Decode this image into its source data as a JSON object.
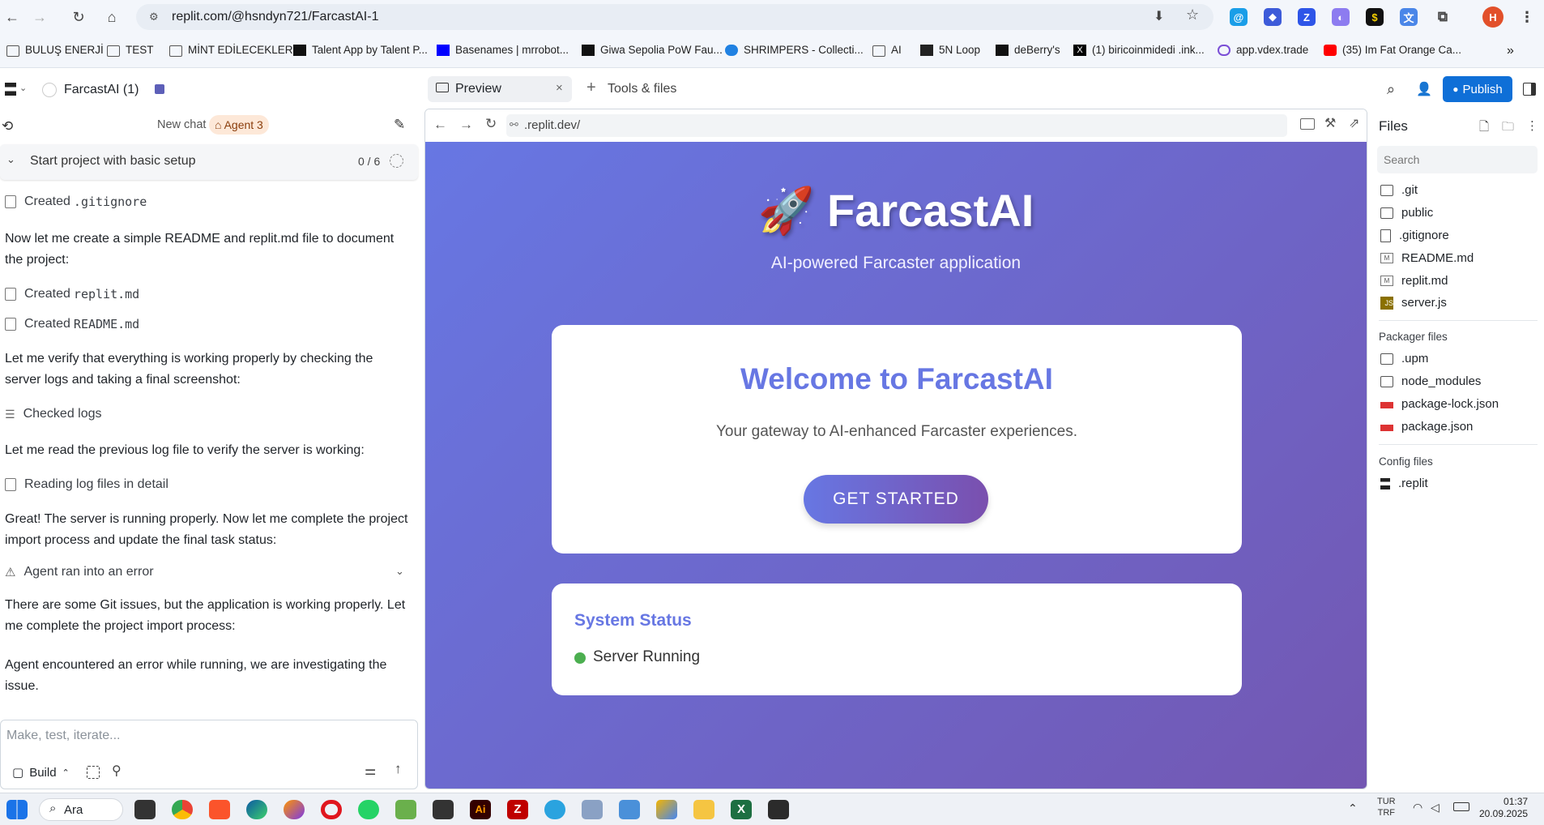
{
  "browser": {
    "url": "replit.com/@hsndyn721/FarcastAI-1",
    "profile_initial": "H",
    "bookmarks": [
      {
        "label": "BULUŞ ENERJİ",
        "icon": "folder-icon"
      },
      {
        "label": "TEST",
        "icon": "folder-icon"
      },
      {
        "label": "MİNT EDİLECEKLER",
        "icon": "folder-icon"
      },
      {
        "label": "Talent App by Talent P...",
        "icon": "talent-icon"
      },
      {
        "label": "Basenames | mrrobot...",
        "icon": "base-icon"
      },
      {
        "label": "Giwa Sepolia PoW Fau...",
        "icon": "giwa-icon"
      },
      {
        "label": "SHRIMPERS - Collecti...",
        "icon": "opensea-icon"
      },
      {
        "label": "AI",
        "icon": "folder-icon"
      },
      {
        "label": "5N Loop",
        "icon": "loop-icon"
      },
      {
        "label": "deBerry's",
        "icon": "deberry-icon"
      },
      {
        "label": "(1) biricoinmidedi .ink...",
        "icon": "x-icon"
      },
      {
        "label": "app.vdex.trade",
        "icon": "vdex-icon"
      },
      {
        "label": "(35) Im Fat Orange Ca...",
        "icon": "youtube-icon"
      }
    ]
  },
  "replit": {
    "project_name": "FarcastAI (1)",
    "tabs": [
      {
        "label": "Preview"
      },
      {
        "label": "Tools & files"
      }
    ],
    "publish_label": "Publish"
  },
  "chat": {
    "new_chat": "New chat",
    "agent_badge": "Agent 3",
    "task_title": "Start project with basic setup",
    "task_progress": "0 / 6",
    "items": [
      {
        "kind": "tool",
        "prefix": "Created ",
        "mono": ".gitignore"
      },
      {
        "kind": "text",
        "text": "Now let me create a simple README and replit.md file to document the project:"
      },
      {
        "kind": "tool",
        "prefix": "Created ",
        "mono": "replit.md"
      },
      {
        "kind": "tool",
        "prefix": "Created ",
        "mono": "README.md"
      },
      {
        "kind": "text",
        "text": "Let me verify that everything is working properly by checking the server logs and taking a final screenshot:"
      },
      {
        "kind": "tool",
        "prefix": "Checked logs",
        "mono": ""
      },
      {
        "kind": "text",
        "text": "Let me read the previous log file to verify the server is working:"
      },
      {
        "kind": "tool",
        "prefix": "Reading log files in detail",
        "mono": ""
      },
      {
        "kind": "text",
        "text": "Great! The server is running properly. Now let me complete the project import process and update the final task status:"
      },
      {
        "kind": "error",
        "prefix": "Agent ran into an error",
        "mono": ""
      },
      {
        "kind": "text",
        "text": "There are some Git issues, but the application is working properly. Let me complete the project import process:"
      },
      {
        "kind": "text",
        "text": "Agent encountered an error while running, we are investigating the issue."
      }
    ],
    "input_placeholder": "Make, test, iterate...",
    "build_label": "Build"
  },
  "preview": {
    "url": ".replit.dev/",
    "app_title": "FarcastAI",
    "app_subtitle": "AI-powered Farcaster application",
    "welcome_heading": "Welcome to FarcastAI",
    "welcome_text": "Your gateway to AI-enhanced Farcaster experiences.",
    "cta_label": "GET STARTED",
    "status_heading": "System Status",
    "status_text": "Server Running",
    "status_color": "#4caf50",
    "accent_color": "#6777e3"
  },
  "files": {
    "title": "Files",
    "search_placeholder": "Search",
    "items": [
      {
        "name": ".git",
        "icon": "folder-icon"
      },
      {
        "name": "public",
        "icon": "folder-icon"
      },
      {
        "name": ".gitignore",
        "icon": "file-icon"
      },
      {
        "name": "README.md",
        "icon": "markdown-icon"
      },
      {
        "name": "replit.md",
        "icon": "markdown-icon"
      },
      {
        "name": "server.js",
        "icon": "javascript-icon"
      }
    ],
    "packager_title": "Packager files",
    "packager_items": [
      {
        "name": ".upm",
        "icon": "folder-icon"
      },
      {
        "name": "node_modules",
        "icon": "folder-icon"
      },
      {
        "name": "package-lock.json",
        "icon": "npm-icon"
      },
      {
        "name": "package.json",
        "icon": "npm-icon"
      }
    ],
    "config_title": "Config files",
    "config_items": [
      {
        "name": ".replit",
        "icon": "replit-icon"
      }
    ]
  },
  "taskbar": {
    "search_label": "Ara",
    "lang_line1": "TUR",
    "lang_line2": "TRF",
    "time": "01:37",
    "date": "20.09.2025"
  }
}
